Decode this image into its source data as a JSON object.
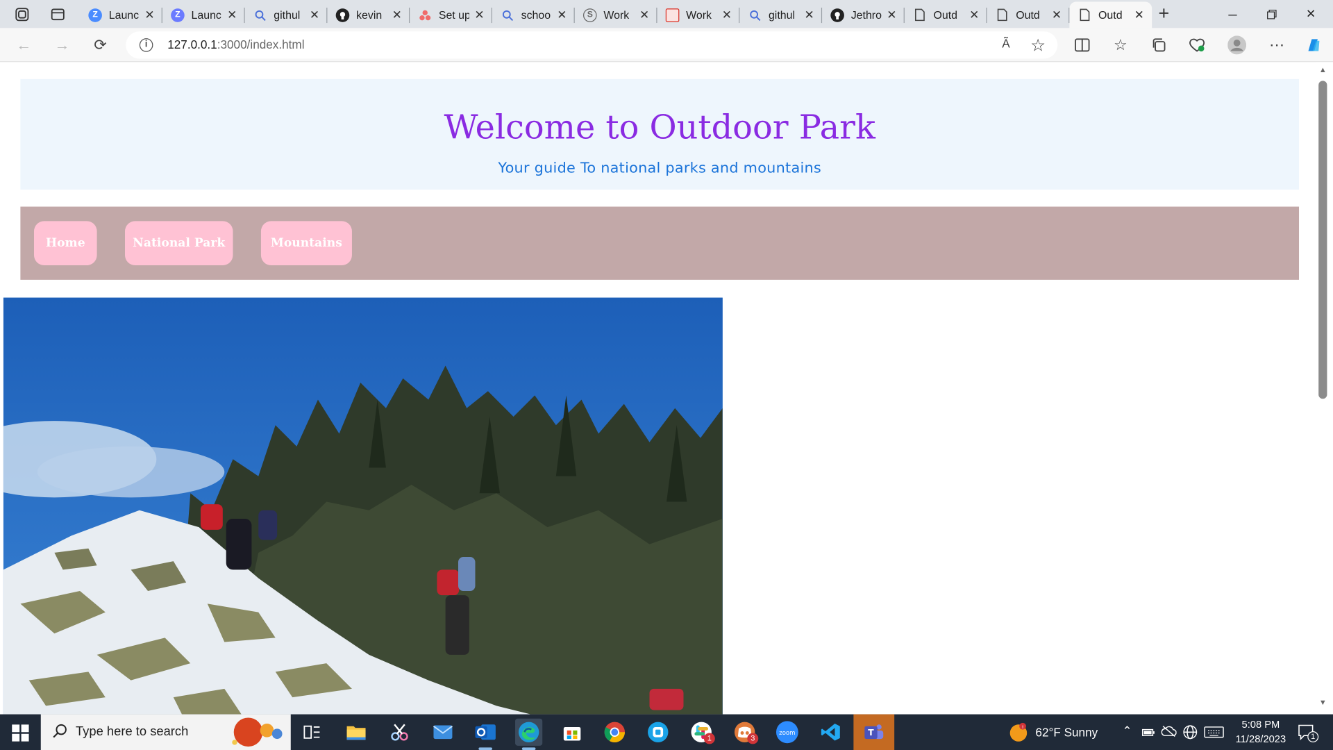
{
  "browser": {
    "tabs": [
      {
        "title": "Launc",
        "icon": "zoom-icon",
        "color": "#4a8cff"
      },
      {
        "title": "Launc",
        "icon": "zoom-icon",
        "color": "#6b7bff"
      },
      {
        "title": "githul",
        "icon": "search-icon",
        "color": "#4a6fd9"
      },
      {
        "title": "kevin",
        "icon": "github-icon",
        "color": "#222222"
      },
      {
        "title": "Set up",
        "icon": "asana-icon",
        "color": "#f06a6a"
      },
      {
        "title": "schoo",
        "icon": "search-icon",
        "color": "#4a6fd9"
      },
      {
        "title": "Work",
        "icon": "copilot-icon",
        "color": "#666666"
      },
      {
        "title": "Work",
        "icon": "pdf-icon",
        "color": "#d93025"
      },
      {
        "title": "githul",
        "icon": "search-icon",
        "color": "#4a6fd9"
      },
      {
        "title": "Jethro",
        "icon": "github-icon",
        "color": "#222222"
      },
      {
        "title": "Outd",
        "icon": "page-icon",
        "color": "#444444"
      },
      {
        "title": "Outd",
        "icon": "page-icon",
        "color": "#444444"
      },
      {
        "title": "Outd",
        "icon": "page-icon",
        "color": "#444444",
        "active": true
      }
    ],
    "url_host": "127.0.0.1",
    "url_rest": ":3000/index.html",
    "read_aloud": "Ã"
  },
  "page": {
    "title": "Welcome to Outdoor Park",
    "subtitle": "Your guide To national parks and mountains",
    "nav": [
      "Home",
      "National Park",
      "Mountains"
    ],
    "colors": {
      "title": "#8a2be2",
      "subtitle": "#1a73d9",
      "header_bg": "#eef6fd",
      "nav_bg": "#c2a8a8",
      "nav_button": "#ffc2d4"
    }
  },
  "taskbar": {
    "search_placeholder": "Type here to search",
    "weather": "62°F  Sunny",
    "time": "5:08 PM",
    "date": "11/28/2023",
    "notification_count": "1",
    "app_badges": {
      "slack": "1",
      "discord": "3"
    }
  }
}
